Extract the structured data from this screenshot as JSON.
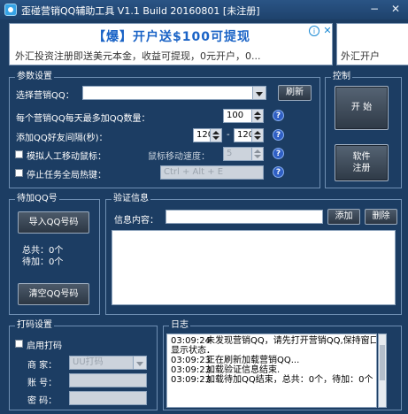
{
  "window": {
    "title": "歪碰营销QQ辅助工具 V1.1 Build 20160801  [未注册]",
    "minimize": "−",
    "close": "✕"
  },
  "ad": {
    "headline": "【爆】开户送$100可提现",
    "subline": "外汇投资注册即送美元本金，收益可提现，0元开户，0...",
    "right_text": "外汇开户",
    "adchoices_icon": "info-icon",
    "close_icon": "close-icon"
  },
  "params": {
    "title": "参数设置",
    "select_qq_label": "选择营销QQ：",
    "select_qq_value": "",
    "refresh": "刷新",
    "max_add_label": "每个营销QQ每天最多加QQ数量：",
    "max_add_value": "100",
    "interval_label": "添加QQ好友间隔(秒)：",
    "interval_min": "120",
    "interval_sep": "-",
    "interval_max": "120",
    "simulate_mouse_label": "模拟人工移动鼠标：",
    "mouse_speed_label": "鼠标移动速度：",
    "mouse_speed_value": "5",
    "hotkey_label": "停止任务全局热键：",
    "hotkey_placeholder": "Ctrl + Alt + E"
  },
  "control": {
    "title": "控制",
    "start": "开  始",
    "register_line1": "软件",
    "register_line2": "注册"
  },
  "pending": {
    "title": "待加QQ号",
    "import": "导入QQ号码",
    "total": "总共：0个",
    "waiting": "待加：0个",
    "clear": "清空QQ号码"
  },
  "verify": {
    "title": "验证信息",
    "content_label": "信息内容：",
    "content_value": "",
    "add": "添加",
    "delete": "删除"
  },
  "captcha": {
    "title": "打码设置",
    "enable_label": "启用打码",
    "vendor_label": "商  家：",
    "vendor_value": "UU打码",
    "account_label": "账  号：",
    "password_label": "密  码："
  },
  "log": {
    "title": "日志",
    "lines": [
      {
        "time": "03:09:24",
        "text": "未发现营销QQ，请先打开营销QQ,保持窗口"
      },
      {
        "time": "",
        "text": "显示状态．"
      },
      {
        "time": "03:09:23",
        "text": "正在刷新加载营销QQ..."
      },
      {
        "time": "03:09:23",
        "text": "加载验证信息结束."
      },
      {
        "time": "03:09:23",
        "text": "加载待加QQ结束，总共：0个，待加：0个"
      }
    ]
  }
}
